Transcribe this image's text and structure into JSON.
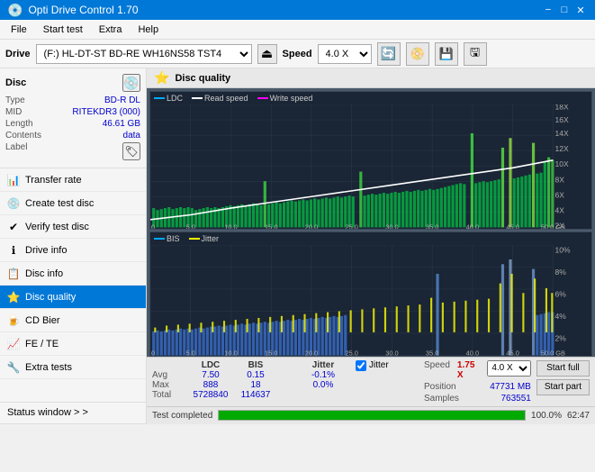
{
  "titleBar": {
    "title": "Opti Drive Control 1.70",
    "minimizeLabel": "−",
    "maximizeLabel": "□",
    "closeLabel": "✕"
  },
  "menuBar": {
    "items": [
      "File",
      "Start test",
      "Extra",
      "Help"
    ]
  },
  "driveToolbar": {
    "driveLabel": "Drive",
    "driveValue": "(F:)  HL-DT-ST BD-RE  WH16NS58 TST4",
    "speedLabel": "Speed",
    "speedValue": "4.0 X"
  },
  "discInfo": {
    "sectionTitle": "Disc",
    "rows": [
      {
        "label": "Type",
        "value": "BD-R DL"
      },
      {
        "label": "MID",
        "value": "RITEKDR3 (000)"
      },
      {
        "label": "Length",
        "value": "46.61 GB"
      },
      {
        "label": "Contents",
        "value": "data"
      },
      {
        "label": "Label",
        "value": ""
      }
    ]
  },
  "navItems": [
    {
      "id": "transfer-rate",
      "label": "Transfer rate",
      "icon": "📊"
    },
    {
      "id": "create-test-disc",
      "label": "Create test disc",
      "icon": "💿"
    },
    {
      "id": "verify-test-disc",
      "label": "Verify test disc",
      "icon": "✔"
    },
    {
      "id": "drive-info",
      "label": "Drive info",
      "icon": "ℹ"
    },
    {
      "id": "disc-info",
      "label": "Disc info",
      "icon": "📋"
    },
    {
      "id": "disc-quality",
      "label": "Disc quality",
      "icon": "⭐",
      "active": true
    },
    {
      "id": "cd-bier",
      "label": "CD Bier",
      "icon": "🍺"
    },
    {
      "id": "fe-te",
      "label": "FE / TE",
      "icon": "📈"
    },
    {
      "id": "extra-tests",
      "label": "Extra tests",
      "icon": "🔧"
    }
  ],
  "statusWindow": {
    "label": "Status window > >"
  },
  "discQuality": {
    "title": "Disc quality",
    "legend": {
      "ldc": "LDC",
      "readSpeed": "Read speed",
      "writeSpeed": "Write speed",
      "bis": "BIS",
      "jitter": "Jitter"
    },
    "upperChart": {
      "yMax": 900,
      "yMin": 100,
      "rightLabels": [
        "18X",
        "16X",
        "14X",
        "12X",
        "10X",
        "8X",
        "6X",
        "4X",
        "2X"
      ],
      "xLabels": [
        "0.0",
        "5.0",
        "10.0",
        "15.0",
        "20.0",
        "25.0",
        "30.0",
        "35.0",
        "40.0",
        "45.0",
        "50.0 GB"
      ]
    },
    "lowerChart": {
      "yMax": 20,
      "yMin": 0,
      "rightLabels": [
        "10%",
        "8%",
        "6%",
        "4%",
        "2%"
      ],
      "xLabels": [
        "0.0",
        "5.0",
        "10.0",
        "15.0",
        "20.0",
        "25.0",
        "30.0",
        "35.0",
        "40.0",
        "45.0",
        "50.0 GB"
      ]
    }
  },
  "stats": {
    "columns": [
      "LDC",
      "BIS",
      "",
      "Jitter"
    ],
    "rows": [
      {
        "label": "Avg",
        "ldc": "7.50",
        "bis": "0.15",
        "jitter": "-0.1%"
      },
      {
        "label": "Max",
        "ldc": "888",
        "bis": "18",
        "jitter": "0.0%"
      },
      {
        "label": "Total",
        "ldc": "5728840",
        "bis": "114637",
        "jitter": ""
      }
    ],
    "jitterLabel": "Jitter",
    "speedLabel": "Speed",
    "speedValue": "1.75 X",
    "speedSelect": "4.0 X",
    "positionLabel": "Position",
    "positionValue": "47731 MB",
    "samplesLabel": "Samples",
    "samplesValue": "763551",
    "startFull": "Start full",
    "startPart": "Start part"
  },
  "progressBar": {
    "percent": 100,
    "statusText": "Test completed",
    "timeText": "62:47"
  }
}
